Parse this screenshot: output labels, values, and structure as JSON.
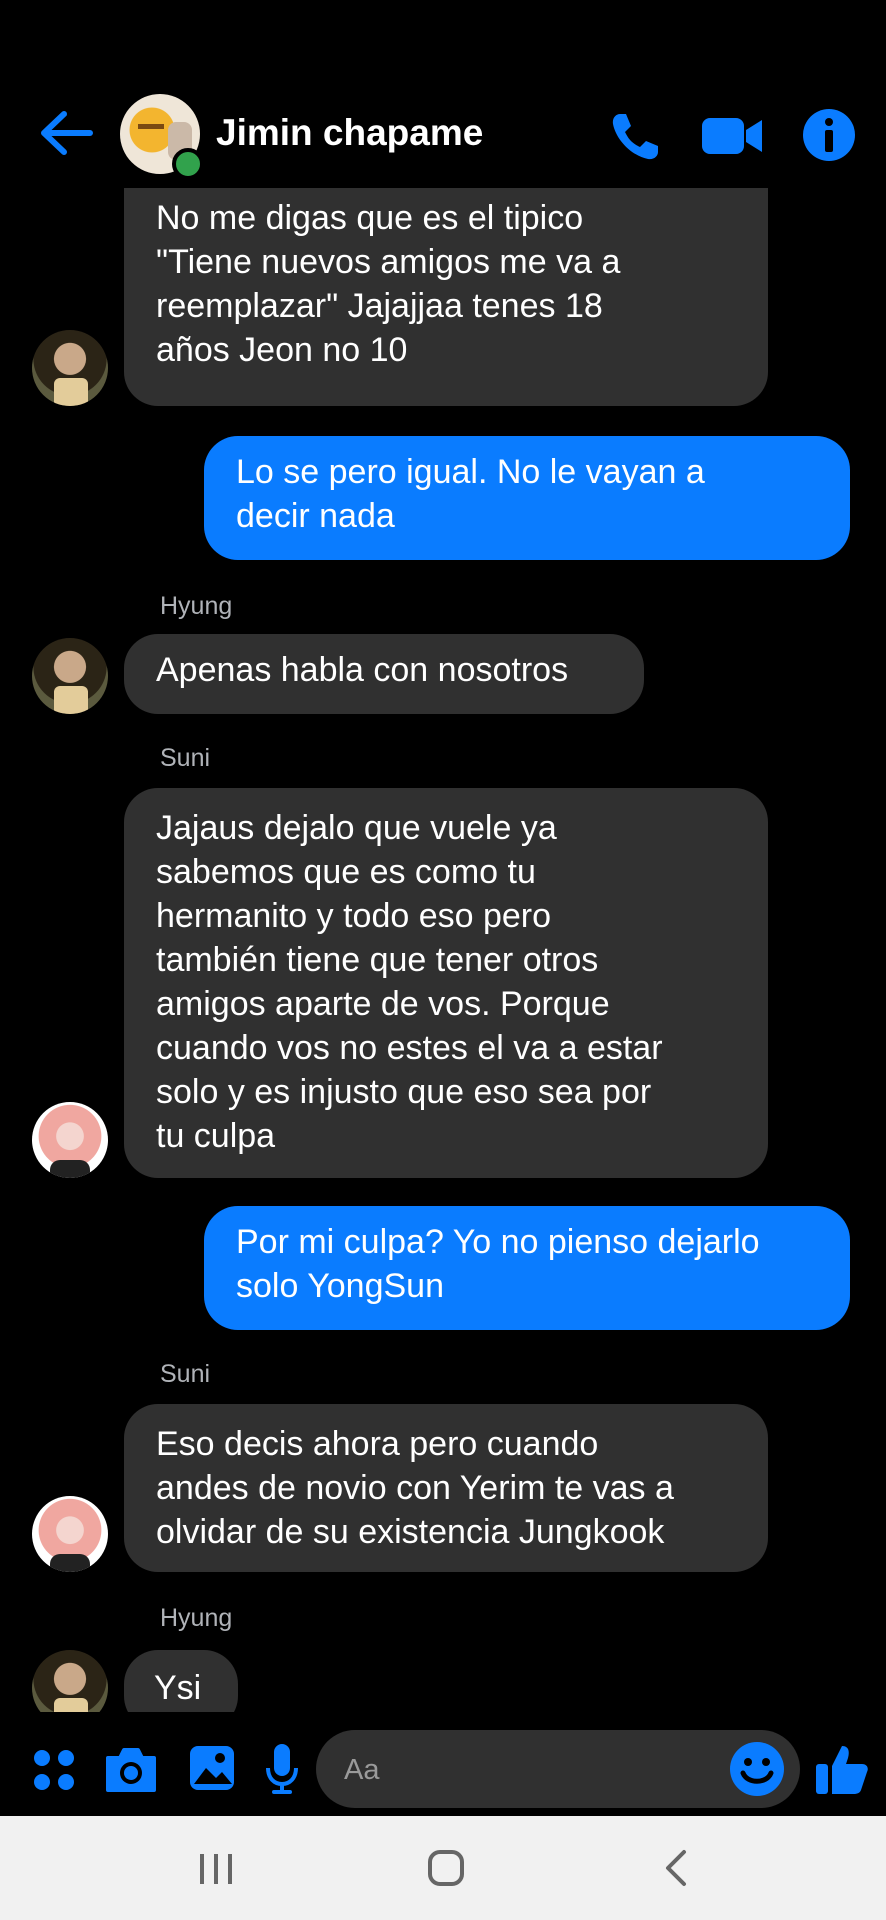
{
  "header": {
    "title": "Jimin chapame",
    "back_icon": "arrow-left-icon",
    "call_icon": "phone-icon",
    "video_icon": "video-camera-icon",
    "info_icon": "info-icon",
    "accent_color": "#0a7cff"
  },
  "messages": [
    {
      "type": "received",
      "sender": "",
      "lines": [
        "No me digas que es el tipico",
        "\"Tiene nuevos amigos me va a",
        "reemplazar\" Jajajjaa tenes 18",
        "años Jeon no 10"
      ]
    },
    {
      "type": "sent",
      "lines": [
        "Lo se pero igual. No le vayan a",
        "decir nada"
      ]
    },
    {
      "type": "received",
      "sender": "Hyung",
      "lines": [
        "Apenas habla con nosotros"
      ]
    },
    {
      "type": "received",
      "sender": "Suni",
      "lines": [
        "Jajaus dejalo que vuele ya",
        "sabemos que es como tu",
        "hermanito y todo eso pero",
        "también tiene que tener otros",
        "amigos aparte de vos. Porque",
        "cuando vos no estes el va a estar",
        "solo y es injusto que eso sea por",
        "tu culpa"
      ]
    },
    {
      "type": "sent",
      "lines": [
        "Por mi culpa? Yo no pienso dejarlo",
        "solo YongSun"
      ]
    },
    {
      "type": "received",
      "sender": "Suni",
      "lines": [
        "Eso decis ahora pero cuando",
        "andes de novio con Yerim te vas a",
        "olvidar de su existencia Jungkook"
      ]
    },
    {
      "type": "received",
      "sender": "Hyung",
      "lines": [
        "Ysi"
      ]
    }
  ],
  "composer": {
    "placeholder": "Aa",
    "icons": [
      "apps-icon",
      "camera-icon",
      "gallery-icon",
      "microphone-icon",
      "emoji-icon",
      "thumbs-up-icon"
    ]
  },
  "navbar": {
    "icons": [
      "recent-apps-icon",
      "home-icon",
      "back-nav-icon"
    ]
  }
}
